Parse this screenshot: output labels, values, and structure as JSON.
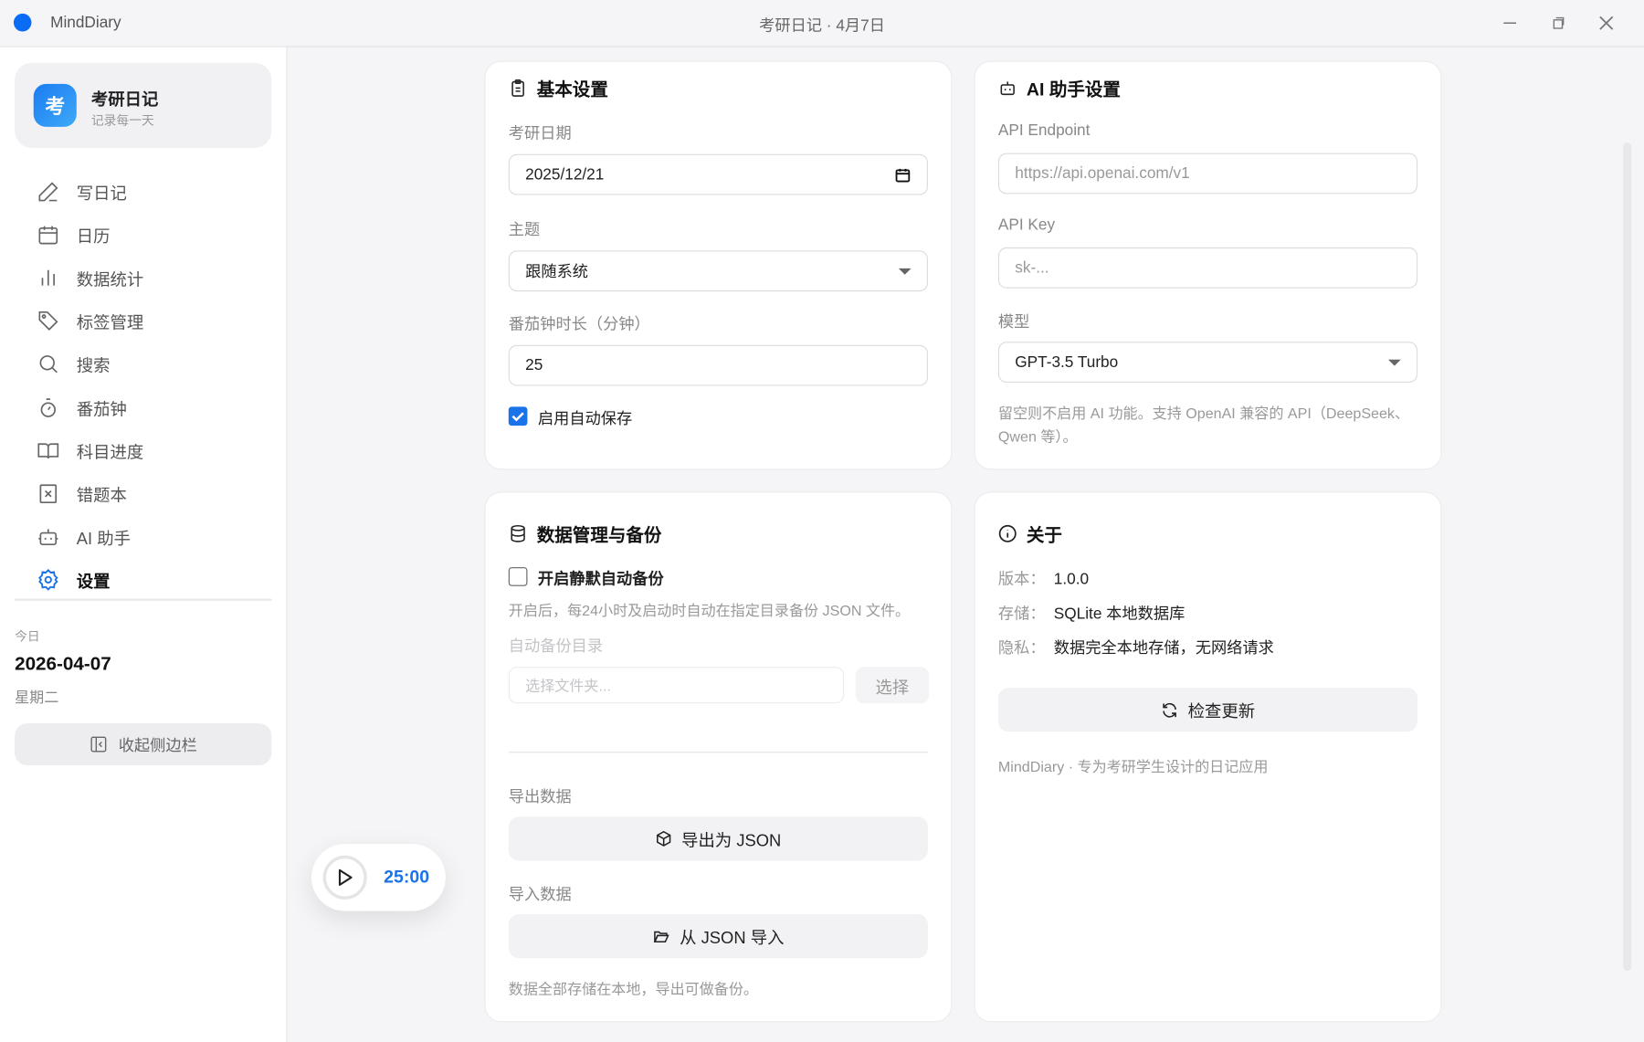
{
  "window": {
    "app_name": "MindDiary",
    "title": "考研日记 · 4月7日"
  },
  "brand": {
    "logo_char": "考",
    "title": "考研日记",
    "subtitle": "记录每一天"
  },
  "sidebar": {
    "items": [
      {
        "label": "写日记",
        "icon": "pencil-icon"
      },
      {
        "label": "日历",
        "icon": "calendar-icon"
      },
      {
        "label": "数据统计",
        "icon": "bar-chart-icon"
      },
      {
        "label": "标签管理",
        "icon": "tag-icon"
      },
      {
        "label": "搜索",
        "icon": "search-icon"
      },
      {
        "label": "番茄钟",
        "icon": "timer-icon"
      },
      {
        "label": "科目进度",
        "icon": "book-icon"
      },
      {
        "label": "错题本",
        "icon": "error-book-icon"
      },
      {
        "label": "AI 助手",
        "icon": "robot-icon"
      },
      {
        "label": "设置",
        "icon": "gear-icon",
        "active": true
      }
    ],
    "today_label": "今日",
    "today_date": "2026-04-07",
    "weekday": "星期二",
    "collapse_label": "收起侧边栏"
  },
  "basic": {
    "title": "基本设置",
    "exam_date_label": "考研日期",
    "exam_date": "2025/12/21",
    "theme_label": "主题",
    "theme": "跟随系统",
    "pomodoro_label": "番茄钟时长（分钟）",
    "pomodoro": "25",
    "autosave_label": "启用自动保存",
    "autosave": true
  },
  "ai": {
    "title": "AI 助手设置",
    "endpoint_label": "API Endpoint",
    "endpoint_placeholder": "https://api.openai.com/v1",
    "key_label": "API Key",
    "key_placeholder": "sk-...",
    "model_label": "模型",
    "model": "GPT-3.5 Turbo",
    "help_line1": "留空则不启用 AI 功能。支持 OpenAI 兼容的 API（DeepSeek、",
    "help_line2": "Qwen 等）。"
  },
  "data": {
    "title": "数据管理与备份",
    "auto_backup_label": "开启静默自动备份",
    "auto_backup": false,
    "auto_backup_desc": "开启后，每24小时及启动时自动在指定目录备份 JSON 文件。",
    "dir_label": "自动备份目录",
    "dir_placeholder": "选择文件夹...",
    "choose_label": "选择",
    "export_label": "导出数据",
    "export_button": "导出为 JSON",
    "import_label": "导入数据",
    "import_button": "从 JSON 导入",
    "note": "数据全部存储在本地，导出可做备份。"
  },
  "about": {
    "title": "关于",
    "version_key": "版本：",
    "version": "1.0.0",
    "storage_key": "存储：",
    "storage": "SQLite 本地数据库",
    "privacy_key": "隐私：",
    "privacy": "数据完全本地存储，无网络请求",
    "check_update": "检查更新",
    "footer": "MindDiary · 专为考研学生设计的日记应用"
  },
  "pomodoro_widget": {
    "time": "25:00"
  },
  "colors": {
    "accent": "#1a73e8",
    "background": "#f5f5f7"
  }
}
